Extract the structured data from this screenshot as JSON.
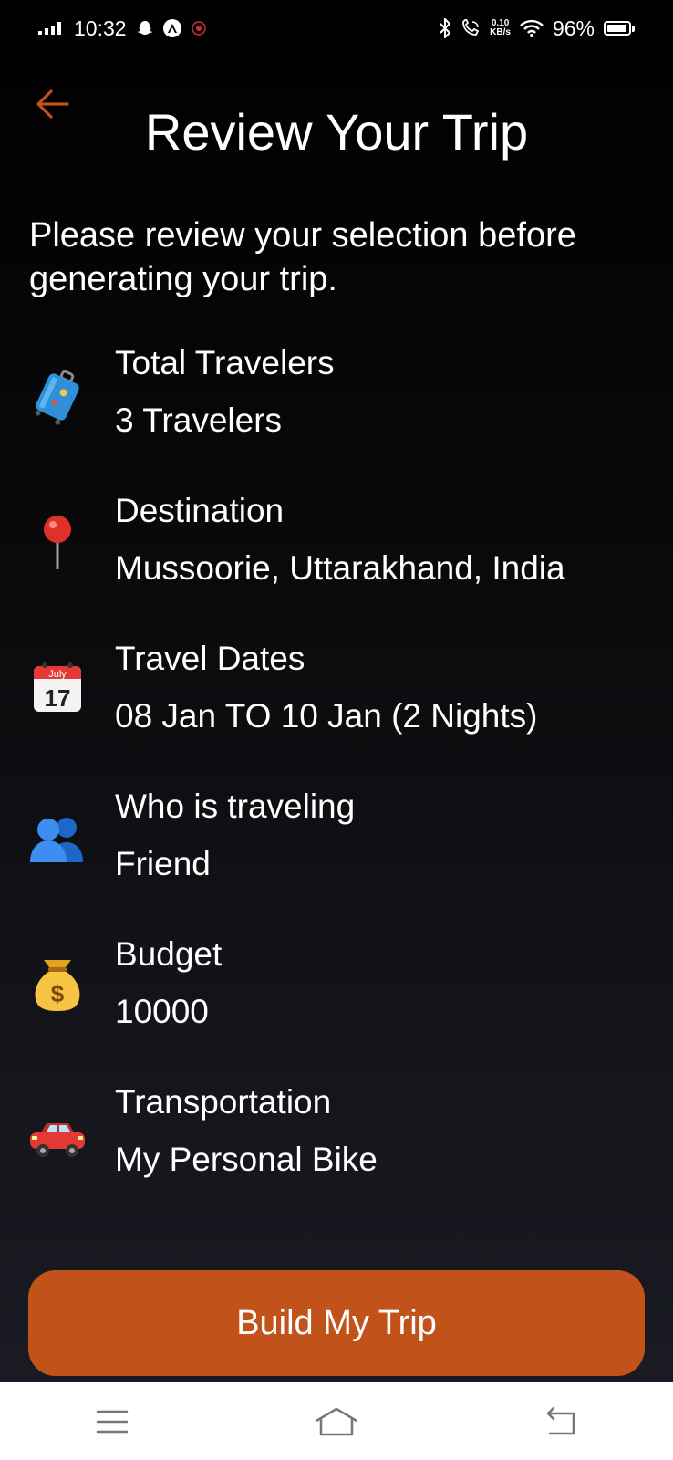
{
  "status_bar": {
    "time": "10:32",
    "net_speed_value": "0.10",
    "net_speed_unit": "KB/s",
    "battery": "96%",
    "battery_level": 0.96
  },
  "header": {
    "title": "Review Your Trip"
  },
  "intro_text": "Please review your selection before generating your trip.",
  "items": [
    {
      "icon": "luggage-icon",
      "label": "Total Travelers",
      "value": "3 Travelers"
    },
    {
      "icon": "map-pin-icon",
      "label": "Destination",
      "value": "Mussoorie, Uttarakhand, India"
    },
    {
      "icon": "calendar-icon",
      "label": "Travel Dates",
      "value": "08 Jan TO 10 Jan (2 Nights)",
      "calendar_month": "July",
      "calendar_day": "17"
    },
    {
      "icon": "people-icon",
      "label": "Who is traveling",
      "value": "Friend"
    },
    {
      "icon": "money-bag-icon",
      "label": "Budget",
      "value": "10000"
    },
    {
      "icon": "car-icon",
      "label": "Transportation",
      "value": "My Personal Bike"
    }
  ],
  "actions": {
    "build_label": "Build My Trip"
  },
  "colors": {
    "accent": "#c1521a",
    "background": "#000000",
    "nav_bar": "#ffffff"
  }
}
